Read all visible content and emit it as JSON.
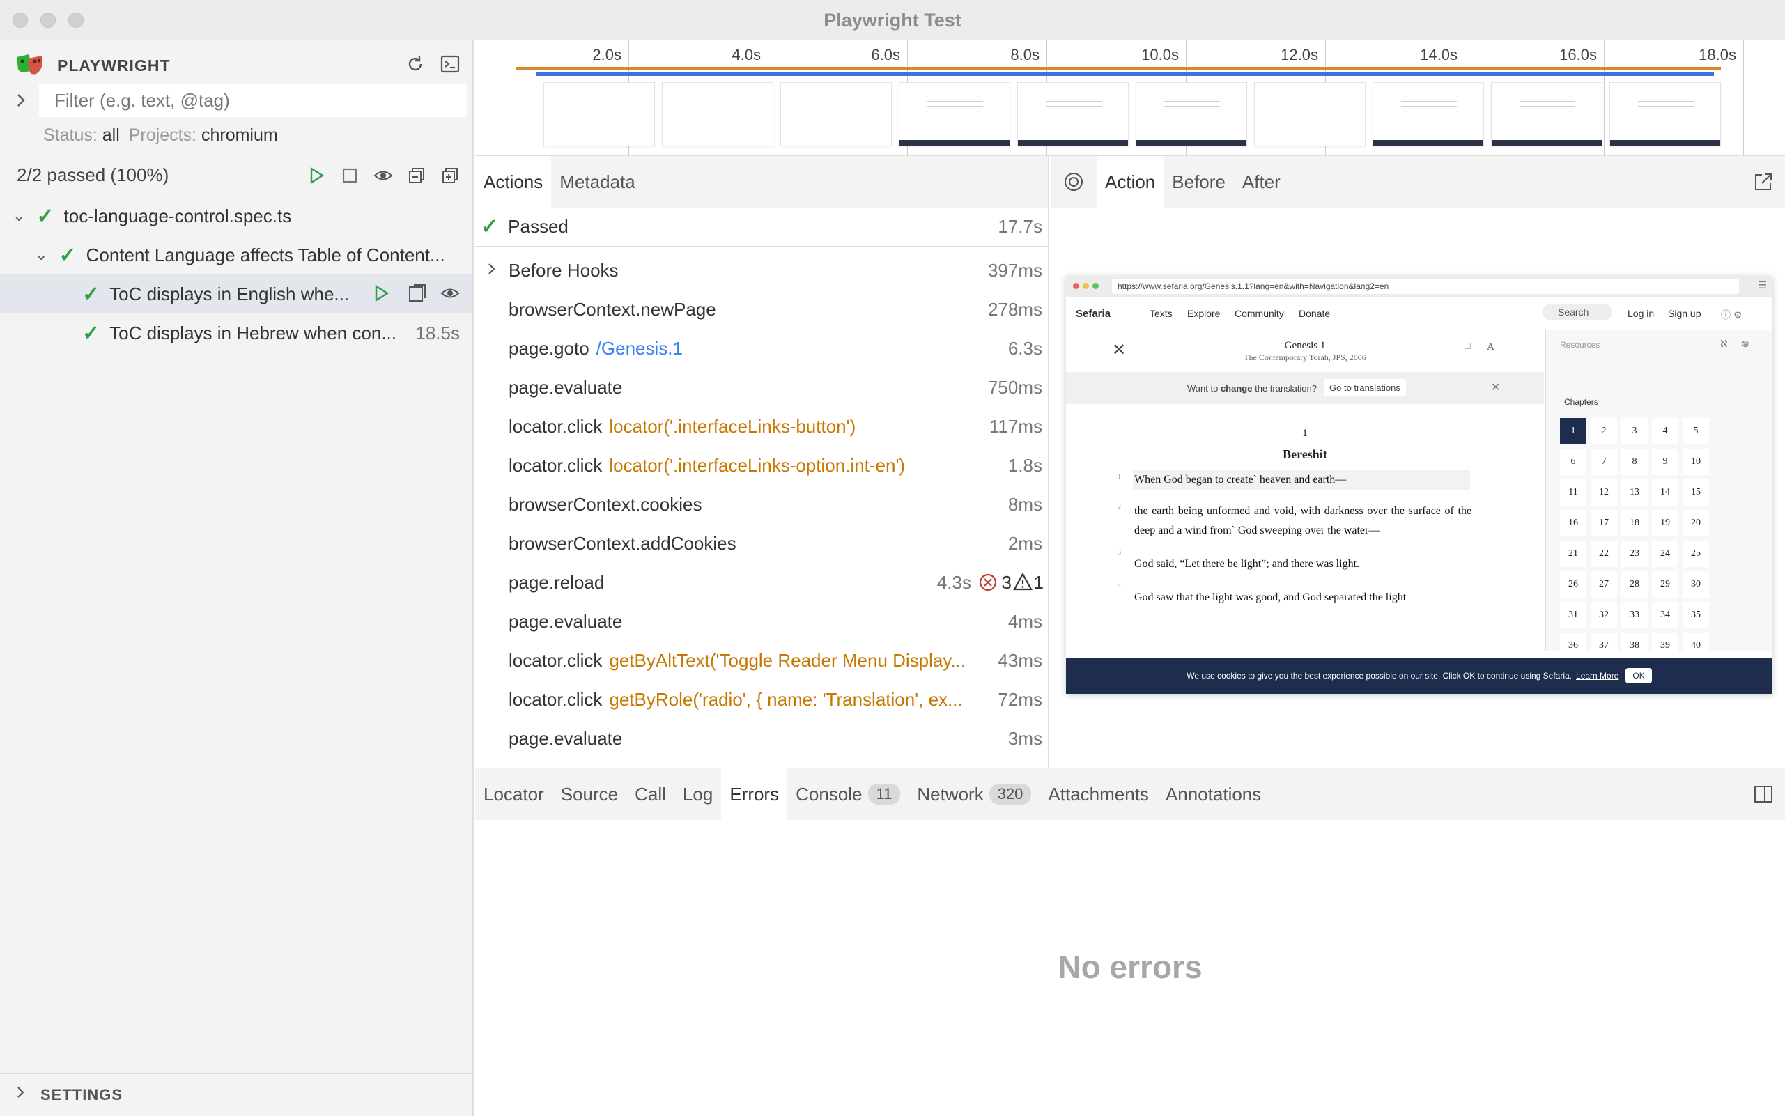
{
  "window": {
    "title": "Playwright Test"
  },
  "sidebar": {
    "brand": "PLAYWRIGHT",
    "filter_placeholder": "Filter (e.g. text, @tag)",
    "status_label": "Status:",
    "status_value": "all",
    "projects_label": "Projects:",
    "projects_value": "chromium",
    "passed_summary": "2/2 passed (100%)",
    "file": "toc-language-control.spec.ts",
    "suite": "Content Language affects Table of Content...",
    "tests": [
      {
        "name": "ToC displays in English whe...",
        "duration": ""
      },
      {
        "name": "ToC displays in Hebrew when con...",
        "duration": "18.5s"
      }
    ],
    "settings_label": "SETTINGS"
  },
  "timeline": {
    "ticks": [
      "2.0s",
      "4.0s",
      "6.0s",
      "8.0s",
      "10.0s",
      "12.0s",
      "14.0s",
      "16.0s",
      "18.0s"
    ]
  },
  "actions_panel": {
    "tabs": [
      "Actions",
      "Metadata"
    ],
    "passed_label": "Passed",
    "passed_time": "17.7s",
    "rows": [
      {
        "name": "Before Hooks",
        "arg": "",
        "time": "397ms"
      },
      {
        "name": "browserContext.newPage",
        "arg": "",
        "time": "278ms"
      },
      {
        "name": "page.goto",
        "link": "/Genesis.1",
        "time": "6.3s"
      },
      {
        "name": "page.evaluate",
        "arg": "",
        "time": "750ms"
      },
      {
        "name": "locator.click",
        "arg": "locator('.interfaceLinks-button')",
        "time": "117ms"
      },
      {
        "name": "locator.click",
        "arg": "locator('.interfaceLinks-option.int-en')",
        "time": "1.8s"
      },
      {
        "name": "browserContext.cookies",
        "arg": "",
        "time": "8ms"
      },
      {
        "name": "browserContext.addCookies",
        "arg": "",
        "time": "2ms"
      },
      {
        "name": "page.reload",
        "arg": "",
        "time": "4.3s",
        "errors": "3",
        "warnings": "1"
      },
      {
        "name": "page.evaluate",
        "arg": "",
        "time": "4ms"
      },
      {
        "name": "locator.click",
        "arg": "getByAltText('Toggle Reader Menu Display...",
        "time": "43ms"
      },
      {
        "name": "locator.click",
        "arg": "getByRole('radio', { name: 'Translation', ex...",
        "time": "72ms"
      },
      {
        "name": "page.evaluate",
        "arg": "",
        "time": "3ms"
      }
    ]
  },
  "snapshot_panel": {
    "tabs": [
      "Action",
      "Before",
      "After"
    ],
    "browser": {
      "url": "https://www.sefaria.org/Genesis.1.1?lang=en&with=Navigation&lang2=en",
      "nav": [
        "Sefaria",
        "Texts",
        "Explore",
        "Community",
        "Donate",
        "Search",
        "Log in",
        "Sign up"
      ],
      "book_title": "Genesis 1",
      "book_subtitle": "The Contemporary Torah, JPS, 2006",
      "translation_prompt_pre": "Want to",
      "translation_prompt_bold": "change",
      "translation_prompt_post": "the translation?",
      "translation_button": "Go to translations",
      "chapter_number": "1",
      "chapter_title": "Bereshit",
      "verses": [
        {
          "n": "1",
          "text": "When God began to create` heaven and earth—"
        },
        {
          "n": "2",
          "text": "the earth being unformed and void, with darkness over the surface of the deep and a wind from` God sweeping over the water—"
        },
        {
          "n": "3",
          "text": "God said, “Let there be light”; and there was light."
        },
        {
          "n": "4",
          "text": "God saw that the light was good, and God separated the light"
        }
      ],
      "resources_label": "Resources",
      "chapters_label": "Chapters",
      "chapters": [
        "1",
        "2",
        "3",
        "4",
        "5",
        "6",
        "7",
        "8",
        "9",
        "10",
        "11",
        "12",
        "13",
        "14",
        "15",
        "16",
        "17",
        "18",
        "19",
        "20",
        "21",
        "22",
        "23",
        "24",
        "25",
        "26",
        "27",
        "28",
        "29",
        "30",
        "31",
        "32",
        "33",
        "34",
        "35",
        "36",
        "37",
        "38",
        "39",
        "40"
      ],
      "cookie_text": "We use cookies to give you the best experience possible on our site. Click OK to continue using Sefaria.",
      "cookie_link": "Learn More",
      "cookie_ok": "OK"
    }
  },
  "bottom_panel": {
    "tabs": [
      {
        "label": "Locator"
      },
      {
        "label": "Source"
      },
      {
        "label": "Call"
      },
      {
        "label": "Log"
      },
      {
        "label": "Errors"
      },
      {
        "label": "Console",
        "badge": "11"
      },
      {
        "label": "Network",
        "badge": "320"
      },
      {
        "label": "Attachments"
      },
      {
        "label": "Annotations"
      }
    ],
    "empty_message": "No errors"
  },
  "colors": {
    "pass": "#2ea043",
    "selector": "#c77800",
    "link": "#3b82f6",
    "error": "#c0392b",
    "selected_row": "#e3e6ed"
  }
}
